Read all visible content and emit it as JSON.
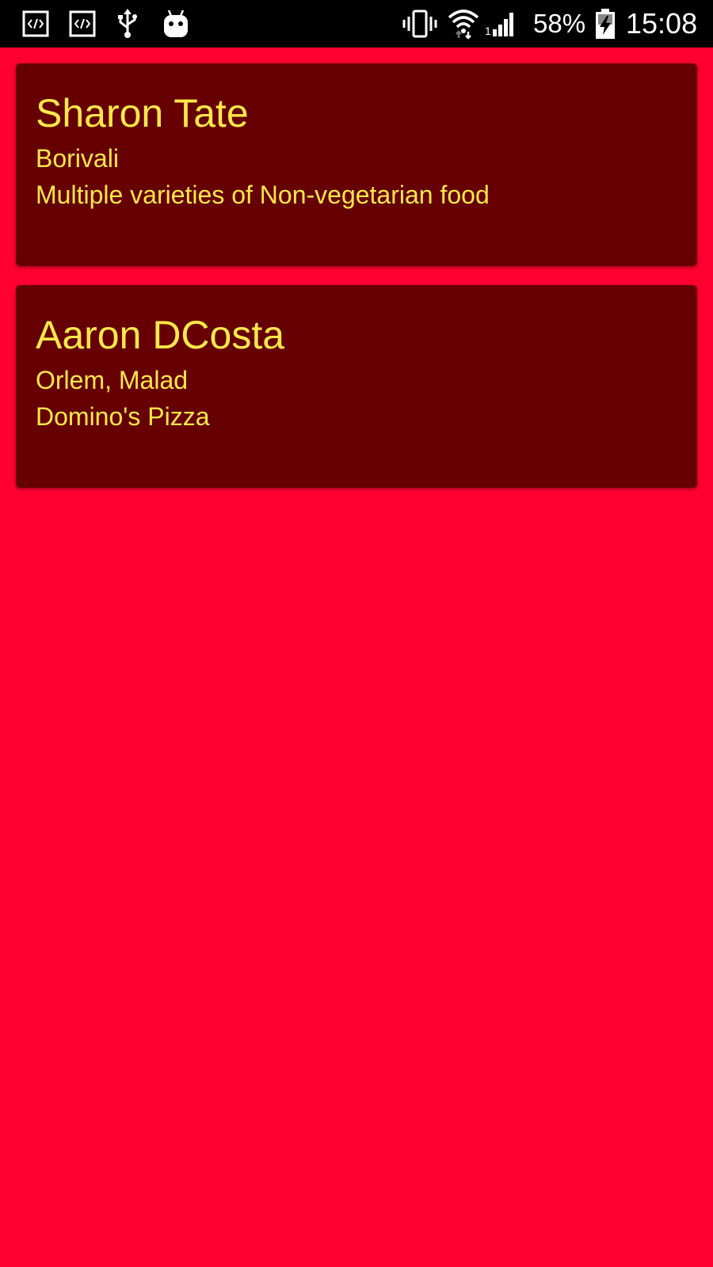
{
  "status_bar": {
    "icons_left": [
      "code-icon",
      "code-icon",
      "usb-icon",
      "android-icon"
    ],
    "icons_right": [
      "vibrate-icon",
      "wifi-icon",
      "signal-icon",
      "battery-charging-icon"
    ],
    "battery_percent": "58%",
    "time": "15:08"
  },
  "theme": {
    "background": "#ff0030",
    "card_background": "#660000",
    "text_color": "#ffe84a"
  },
  "list": {
    "items": [
      {
        "name": "Sharon Tate",
        "location": "Borivali",
        "description": "Multiple varieties of Non-vegetarian food"
      },
      {
        "name": "Aaron DCosta",
        "location": "Orlem, Malad",
        "description": "Domino's Pizza"
      }
    ]
  }
}
